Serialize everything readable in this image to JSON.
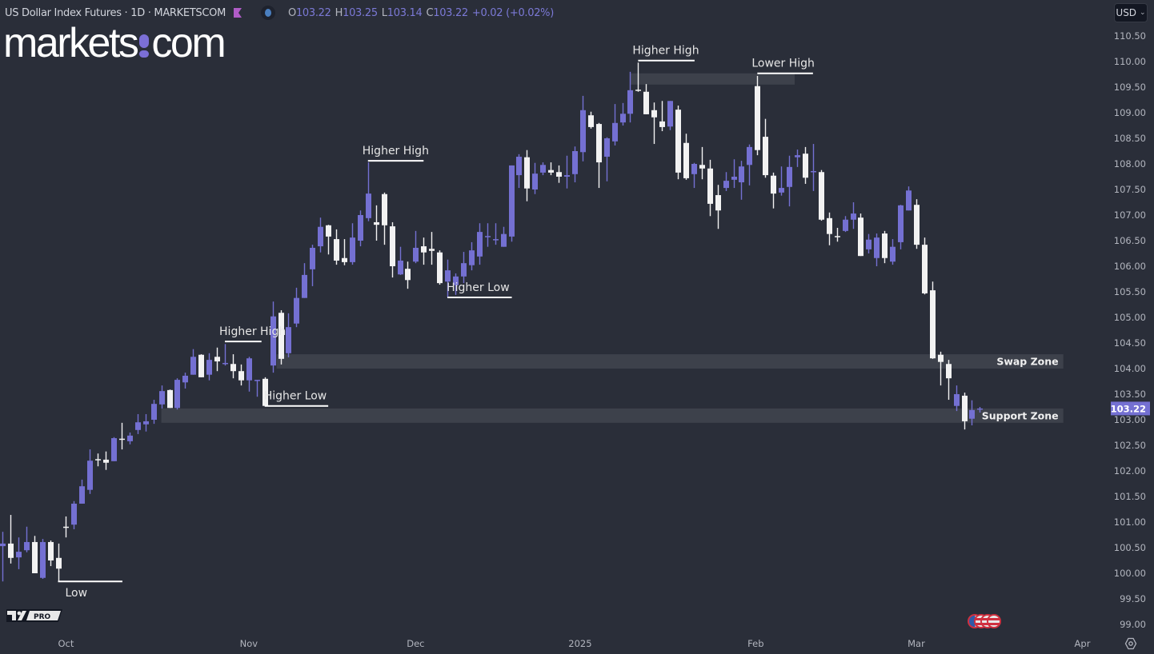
{
  "header": {
    "title": "US Dollar Index Futures · 1D · MARKETSCOM",
    "ohlc": [
      {
        "key": "O",
        "value": "103.22"
      },
      {
        "key": "H",
        "value": "103.25"
      },
      {
        "key": "L",
        "value": "103.14"
      },
      {
        "key": "C",
        "value": "103.22"
      }
    ],
    "change": "+0.02 (+0.02%)",
    "flag_icon": "flag-icon",
    "status_icon": "market-status-icon"
  },
  "logo": {
    "left": "markets",
    "right": "com"
  },
  "currency": {
    "label": "USD",
    "icon": "chevron-down-icon"
  },
  "watermark": {
    "label": "PRO",
    "icon": "tradingview-logo-icon"
  },
  "events": {
    "icon": "us-flag-event-icon",
    "count": 4
  },
  "settings": {
    "icon": "settings-hexagon-icon"
  },
  "colors": {
    "background": "#2a2e39",
    "bullish": "#7470d2",
    "bearish": "#f2f2f2",
    "zone": "#3d414b",
    "annotation": "#ffffff",
    "price_tag": "#7470d2",
    "axis_text": "#b2b5be"
  },
  "chart_data": {
    "type": "candlestick",
    "title": "US Dollar Index Futures · 1D · MARKETSCOM",
    "ylim": [
      98.9,
      110.75
    ],
    "y_ticks": [
      "110.50",
      "110.00",
      "109.50",
      "109.00",
      "108.50",
      "108.00",
      "107.50",
      "107.00",
      "106.50",
      "106.00",
      "105.50",
      "105.00",
      "104.50",
      "104.00",
      "103.50",
      "103.00",
      "102.50",
      "102.00",
      "101.50",
      "101.00",
      "100.50",
      "100.00",
      "99.50",
      "99.00"
    ],
    "x_ticks": [
      {
        "label": "Oct",
        "index": 8
      },
      {
        "label": "Nov",
        "index": 31
      },
      {
        "label": "Dec",
        "index": 52
      },
      {
        "label": "2025",
        "index": 72.7
      },
      {
        "label": "Feb",
        "index": 94.8
      },
      {
        "label": "Mar",
        "index": 115
      },
      {
        "label": "Apr",
        "index": 135.9
      }
    ],
    "last_price": "103.22",
    "ohlc": [
      [
        100.53,
        100.81,
        99.84,
        100.58
      ],
      [
        100.58,
        101.14,
        100.19,
        100.3
      ],
      [
        100.31,
        100.7,
        100.08,
        100.42
      ],
      [
        100.45,
        100.91,
        100.41,
        100.61
      ],
      [
        100.61,
        100.73,
        100.0,
        100.0
      ],
      [
        99.91,
        100.67,
        99.89,
        100.61
      ],
      [
        100.61,
        100.64,
        100.14,
        100.25
      ],
      [
        100.3,
        100.58,
        99.83,
        100.09
      ],
      [
        100.91,
        101.11,
        100.7,
        100.89
      ],
      [
        100.95,
        101.41,
        100.86,
        101.36
      ],
      [
        101.36,
        101.83,
        101.36,
        101.7
      ],
      [
        101.63,
        102.42,
        101.55,
        102.2
      ],
      [
        102.23,
        102.34,
        102.09,
        102.22
      ],
      [
        102.22,
        102.38,
        102.02,
        102.16
      ],
      [
        102.19,
        102.66,
        102.19,
        102.64
      ],
      [
        102.63,
        102.94,
        102.42,
        102.61
      ],
      [
        102.58,
        102.75,
        102.52,
        102.69
      ],
      [
        102.8,
        103.11,
        102.72,
        102.95
      ],
      [
        102.91,
        103.11,
        102.77,
        102.97
      ],
      [
        103.0,
        103.39,
        102.92,
        103.31
      ],
      [
        103.3,
        103.67,
        103.22,
        103.56
      ],
      [
        103.58,
        103.59,
        103.23,
        103.23
      ],
      [
        103.23,
        103.81,
        103.2,
        103.78
      ],
      [
        103.73,
        103.92,
        103.61,
        103.86
      ],
      [
        103.88,
        104.38,
        103.88,
        104.23
      ],
      [
        104.27,
        104.28,
        103.83,
        103.83
      ],
      [
        103.88,
        104.3,
        103.77,
        104.17
      ],
      [
        104.23,
        104.41,
        103.95,
        104.14
      ],
      [
        104.09,
        104.48,
        104.06,
        104.11
      ],
      [
        104.09,
        104.28,
        103.81,
        103.95
      ],
      [
        103.95,
        104.08,
        103.67,
        103.77
      ],
      [
        103.77,
        104.23,
        103.55,
        104.2
      ],
      [
        103.77,
        103.78,
        103.45,
        103.78
      ],
      [
        103.8,
        103.83,
        103.27,
        103.27
      ],
      [
        104.06,
        105.31,
        103.92,
        105.02
      ],
      [
        105.09,
        105.14,
        104.08,
        104.19
      ],
      [
        104.3,
        105.08,
        104.22,
        104.81
      ],
      [
        104.88,
        105.58,
        104.81,
        105.38
      ],
      [
        105.38,
        106.06,
        105.38,
        105.83
      ],
      [
        105.94,
        106.42,
        105.61,
        106.36
      ],
      [
        106.39,
        106.95,
        106.27,
        106.77
      ],
      [
        106.8,
        106.81,
        106.23,
        106.58
      ],
      [
        106.53,
        106.72,
        106.03,
        106.11
      ],
      [
        106.16,
        106.53,
        106.02,
        106.08
      ],
      [
        106.08,
        106.84,
        106.03,
        106.56
      ],
      [
        106.5,
        107.09,
        106.39,
        107.0
      ],
      [
        106.94,
        108.03,
        106.88,
        107.42
      ],
      [
        106.86,
        107.19,
        106.5,
        106.81
      ],
      [
        107.41,
        107.44,
        106.42,
        106.8
      ],
      [
        106.78,
        106.86,
        105.78,
        106.0
      ],
      [
        105.84,
        106.38,
        105.83,
        106.11
      ],
      [
        105.95,
        106.09,
        105.56,
        105.73
      ],
      [
        106.09,
        106.69,
        106.06,
        106.36
      ],
      [
        106.39,
        106.56,
        106.03,
        106.27
      ],
      [
        106.34,
        106.67,
        106.03,
        106.3
      ],
      [
        106.27,
        106.31,
        105.64,
        105.67
      ],
      [
        105.7,
        106.13,
        105.39,
        105.92
      ],
      [
        105.63,
        105.86,
        105.44,
        105.8
      ],
      [
        105.8,
        106.28,
        105.67,
        106.06
      ],
      [
        106.02,
        106.47,
        105.92,
        106.31
      ],
      [
        106.19,
        106.84,
        106.03,
        106.67
      ],
      [
        106.58,
        106.84,
        106.38,
        106.59
      ],
      [
        106.52,
        106.84,
        106.42,
        106.53
      ],
      [
        106.38,
        106.77,
        106.38,
        106.63
      ],
      [
        106.58,
        107.97,
        106.48,
        107.97
      ],
      [
        107.78,
        108.19,
        107.53,
        108.14
      ],
      [
        108.13,
        108.27,
        107.27,
        107.52
      ],
      [
        107.5,
        108.02,
        107.41,
        107.81
      ],
      [
        107.83,
        108.03,
        107.78,
        107.98
      ],
      [
        107.88,
        108.03,
        107.78,
        107.83
      ],
      [
        107.84,
        107.97,
        107.63,
        107.75
      ],
      [
        107.75,
        108.16,
        107.52,
        107.78
      ],
      [
        107.8,
        108.34,
        107.64,
        108.25
      ],
      [
        108.23,
        109.33,
        108.05,
        109.05
      ],
      [
        108.95,
        109.02,
        108.69,
        108.72
      ],
      [
        108.78,
        108.8,
        107.53,
        108.03
      ],
      [
        108.14,
        108.52,
        107.66,
        108.5
      ],
      [
        108.44,
        109.17,
        108.36,
        108.8
      ],
      [
        108.81,
        109.19,
        108.75,
        108.98
      ],
      [
        108.98,
        109.8,
        108.81,
        109.44
      ],
      [
        109.45,
        109.98,
        109.41,
        109.44
      ],
      [
        109.41,
        109.56,
        108.97,
        108.97
      ],
      [
        109.05,
        109.2,
        108.39,
        108.91
      ],
      [
        108.83,
        109.23,
        108.64,
        108.72
      ],
      [
        108.73,
        109.23,
        108.66,
        109.23
      ],
      [
        109.06,
        109.14,
        107.7,
        107.83
      ],
      [
        108.41,
        108.59,
        107.69,
        107.72
      ],
      [
        107.8,
        108.02,
        107.53,
        108.0
      ],
      [
        107.98,
        108.33,
        107.7,
        107.91
      ],
      [
        107.91,
        108.08,
        106.98,
        107.22
      ],
      [
        107.39,
        107.59,
        106.73,
        107.09
      ],
      [
        107.53,
        107.84,
        107.47,
        107.67
      ],
      [
        107.69,
        108.09,
        107.53,
        107.75
      ],
      [
        107.64,
        108.06,
        107.3,
        107.95
      ],
      [
        107.98,
        108.38,
        107.58,
        108.33
      ],
      [
        109.52,
        109.72,
        108.17,
        108.27
      ],
      [
        108.53,
        108.88,
        107.73,
        107.78
      ],
      [
        107.77,
        107.83,
        107.13,
        107.42
      ],
      [
        107.44,
        107.95,
        107.38,
        107.53
      ],
      [
        107.55,
        108.16,
        107.17,
        107.94
      ],
      [
        108.13,
        108.28,
        107.94,
        108.17
      ],
      [
        108.2,
        108.33,
        107.61,
        107.73
      ],
      [
        107.84,
        108.39,
        107.47,
        107.86
      ],
      [
        107.84,
        107.88,
        106.89,
        106.91
      ],
      [
        106.94,
        107.05,
        106.41,
        106.63
      ],
      [
        106.59,
        106.75,
        106.48,
        106.58
      ],
      [
        106.69,
        106.98,
        106.67,
        106.91
      ],
      [
        106.91,
        107.25,
        106.73,
        107.03
      ],
      [
        106.95,
        107.03,
        106.2,
        106.2
      ],
      [
        106.33,
        106.63,
        106.25,
        106.52
      ],
      [
        106.16,
        106.64,
        106.0,
        106.56
      ],
      [
        106.64,
        106.69,
        106.06,
        106.16
      ],
      [
        106.09,
        106.53,
        106.03,
        106.38
      ],
      [
        106.47,
        107.2,
        106.33,
        107.19
      ],
      [
        107.09,
        107.56,
        107.09,
        107.48
      ],
      [
        107.2,
        107.31,
        106.34,
        106.42
      ],
      [
        106.42,
        106.56,
        105.45,
        105.47
      ],
      [
        105.53,
        105.7,
        104.19,
        104.2
      ],
      [
        104.27,
        104.33,
        103.67,
        104.13
      ],
      [
        104.09,
        104.17,
        103.39,
        103.81
      ],
      [
        103.27,
        103.67,
        103.17,
        103.5
      ],
      [
        103.47,
        103.53,
        102.81,
        102.97
      ],
      [
        103.02,
        103.38,
        102.89,
        103.19
      ],
      [
        103.22,
        103.25,
        103.14,
        103.22
      ]
    ],
    "zones": [
      {
        "name": "swap-zone",
        "label": "Swap Zone",
        "from_index": 34.5,
        "to_index": 133.5,
        "top": 104.28,
        "bottom": 104.0
      },
      {
        "name": "support-zone",
        "label": "Support Zone",
        "from_index": 20,
        "to_index": 133.5,
        "top": 103.22,
        "bottom": 102.94
      },
      {
        "name": "top-zone",
        "label": "",
        "from_index": 79,
        "to_index": 99.7,
        "top": 109.77,
        "bottom": 109.55
      }
    ],
    "annotations": [
      {
        "name": "low",
        "label": "Low",
        "price": 99.84,
        "from_index": 7,
        "to_index": 15.1
      },
      {
        "name": "higher-high-1",
        "label": "Higher High",
        "price": 104.53,
        "from_index": 28,
        "to_index": 32.6
      },
      {
        "name": "higher-low-1",
        "label": "Higher Low",
        "price": 103.27,
        "from_index": 33,
        "to_index": 41
      },
      {
        "name": "higher-high-2",
        "label": "Higher High",
        "price": 108.06,
        "from_index": 46,
        "to_index": 53
      },
      {
        "name": "higher-low-2",
        "label": "Higher Low",
        "price": 105.39,
        "from_index": 56,
        "to_index": 64.1
      },
      {
        "name": "higher-high-3",
        "label": "Higher High",
        "price": 110.02,
        "from_index": 80,
        "to_index": 87.1
      },
      {
        "name": "lower-high",
        "label": "Lower High",
        "price": 109.77,
        "from_index": 95,
        "to_index": 102
      }
    ]
  }
}
